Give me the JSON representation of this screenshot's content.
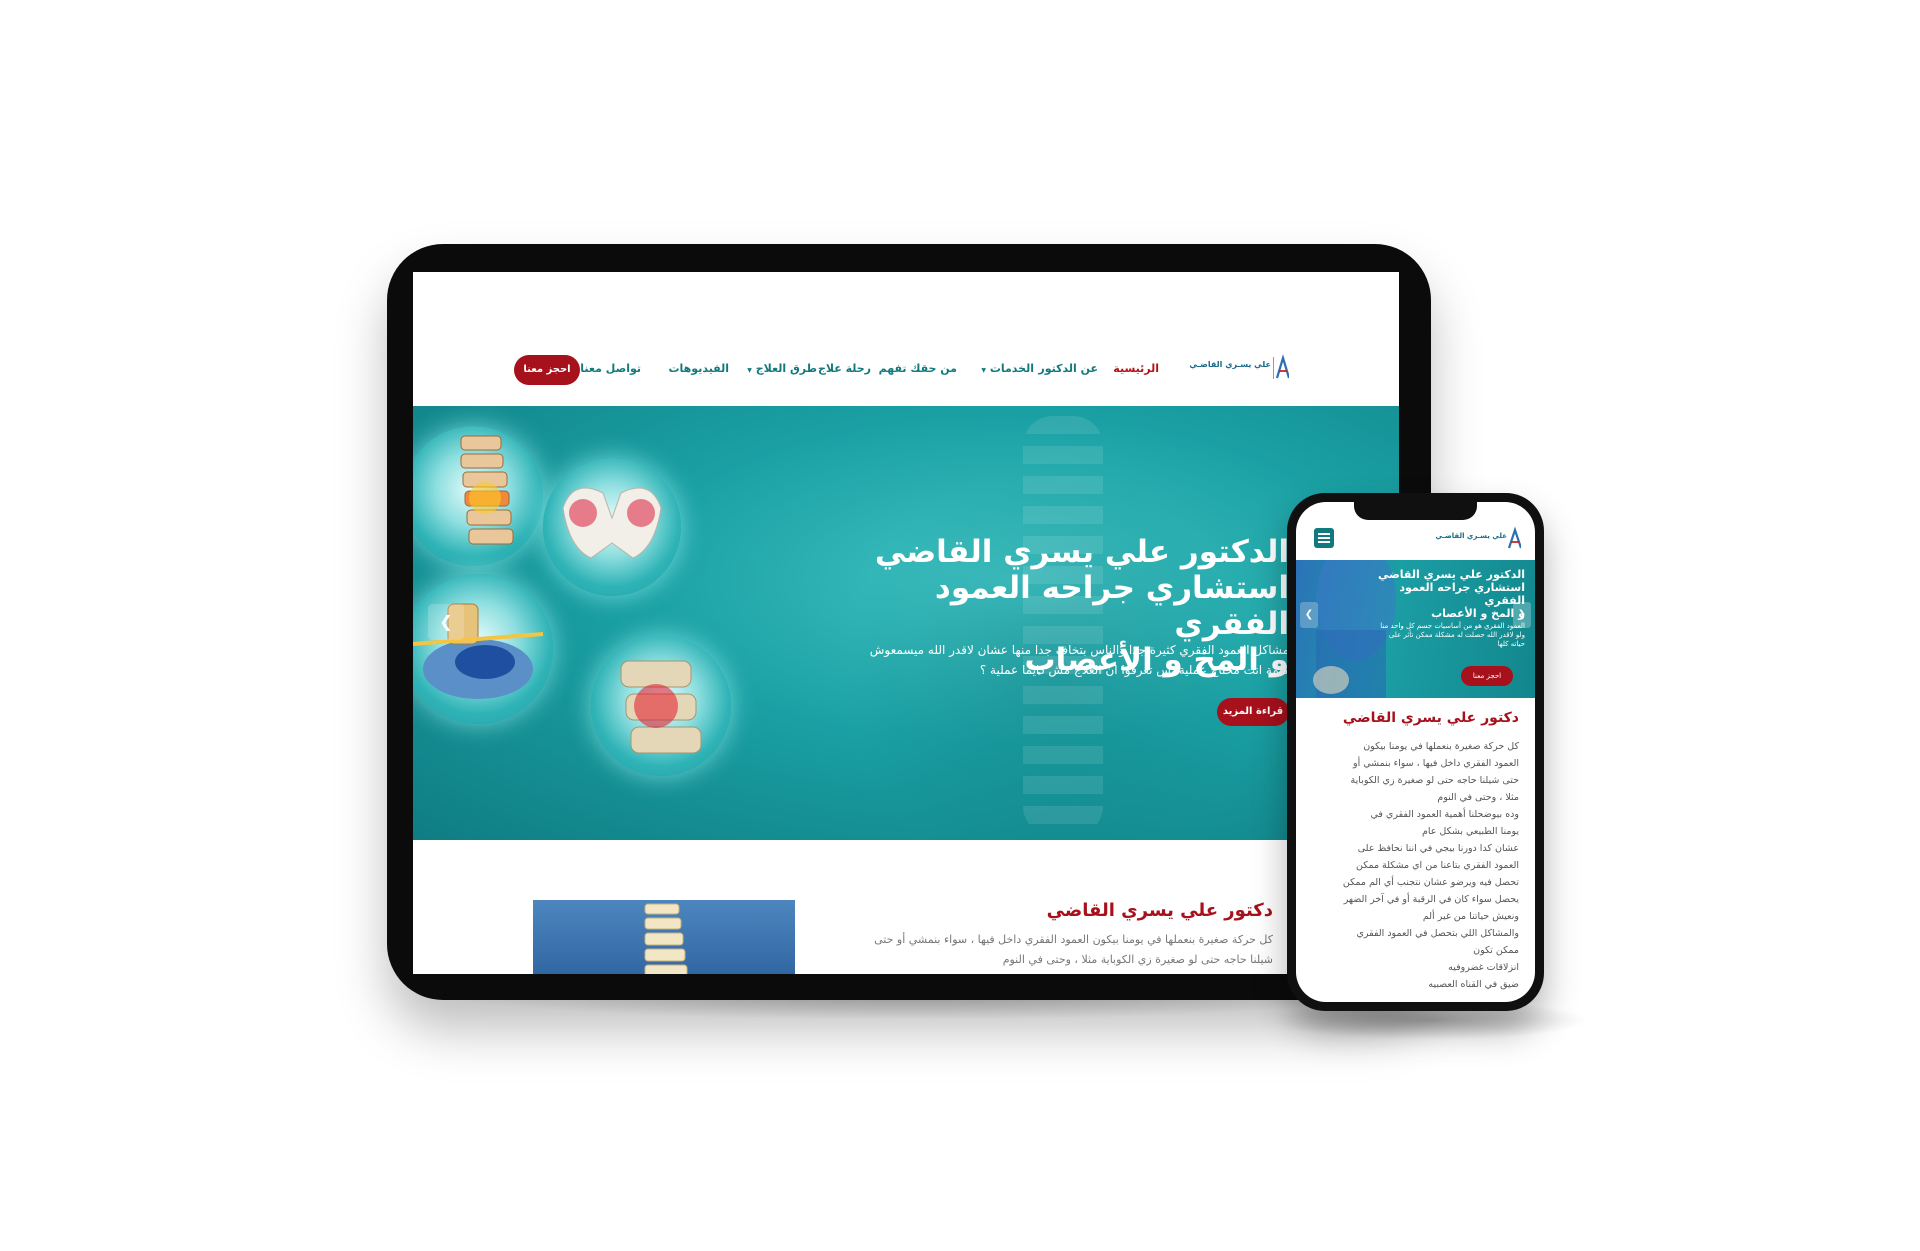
{
  "tablet": {
    "nav": {
      "home": "الرئيسية",
      "about": "عن الدكتور",
      "services": "الخدمات",
      "rights": "من حقك تفهم",
      "journey": "رحلة علاج",
      "treatments": "طرق العلاج",
      "videos": "الفيديوهات",
      "contact": "تواصل معنا",
      "book": "احجز معنا"
    },
    "logo_text": "علي يسـري القاضـي",
    "hero": {
      "title_line1": "الدكتور علي يسري القاضي",
      "title_line2": "استشاري جراحه العمود الفقري",
      "title_line3": "و المخ و الأعصاب",
      "text": "مشاكل العمود الفقري كثيرة جدا والناس بتخاف جدا منها عشان لاقدر الله ميسمعوش كلمة انت محتاج عملية بس تعرفوا ان العلاج مش دايما عملية ؟",
      "read_more": "قراءة المزيد"
    },
    "section": {
      "title": "دكتور علي يسري القاضي",
      "text": "كل حركة صغيرة بنعملها في يومنا بيكون العمود الفقري داخل فيها ، سواء بنمشي أو حتى شيلنا حاجه حتى لو صغيرة زي الكوباية مثلا ، وحتى في النوم"
    }
  },
  "phone": {
    "logo_text": "علي يسـري القاضـي",
    "hero": {
      "title_line1": "الدكتور علي يسري القاضي",
      "title_line2": "استشاري جراحه العمود الفقري",
      "title_line3": "و المخ و الأعصاب",
      "text": "العمود الفقري هو من أساسيات جسم كل واحد منا ولو لاقدر الله حصلت له مشكلة ممكن تأثر على حياته كلها",
      "book": "احجز معنا"
    },
    "section": {
      "title": "دكتور علي يسري القاضي",
      "lines": [
        "كل حركة صغيرة بنعملها في يومنا بيكون",
        "العمود الفقري داخل فيها ، سواء بنمشي أو",
        "حتى شيلنا حاجه حتى لو صغيرة زي الكوباية",
        "مثلا ، وحتى في النوم",
        "وده بيوضحلنا أهمية العمود الفقري في",
        "يومنا الطبيعي بشكل عام",
        "عشان كدا دورنا بيجي في اننا نحافظ على",
        "العمود الفقري بتاعنا من اي مشكلة ممكن",
        "تحصل فيه ويرضو عشان نتجنب أي الم ممكن",
        "يحصل سواء كان في الرقبة أو في آخر الضهر",
        "ونعيش حياتنا من غير ألم",
        "والمشاكل اللي بتحصل في العمود الفقري",
        "ممكن تكون",
        "انزلاقات غضروفيه",
        "ضيق في القناه العصبيه"
      ]
    }
  },
  "colors": {
    "brand_red": "#a6111b",
    "brand_teal": "#117a7c",
    "hero_teal": "#1aa0a3"
  }
}
